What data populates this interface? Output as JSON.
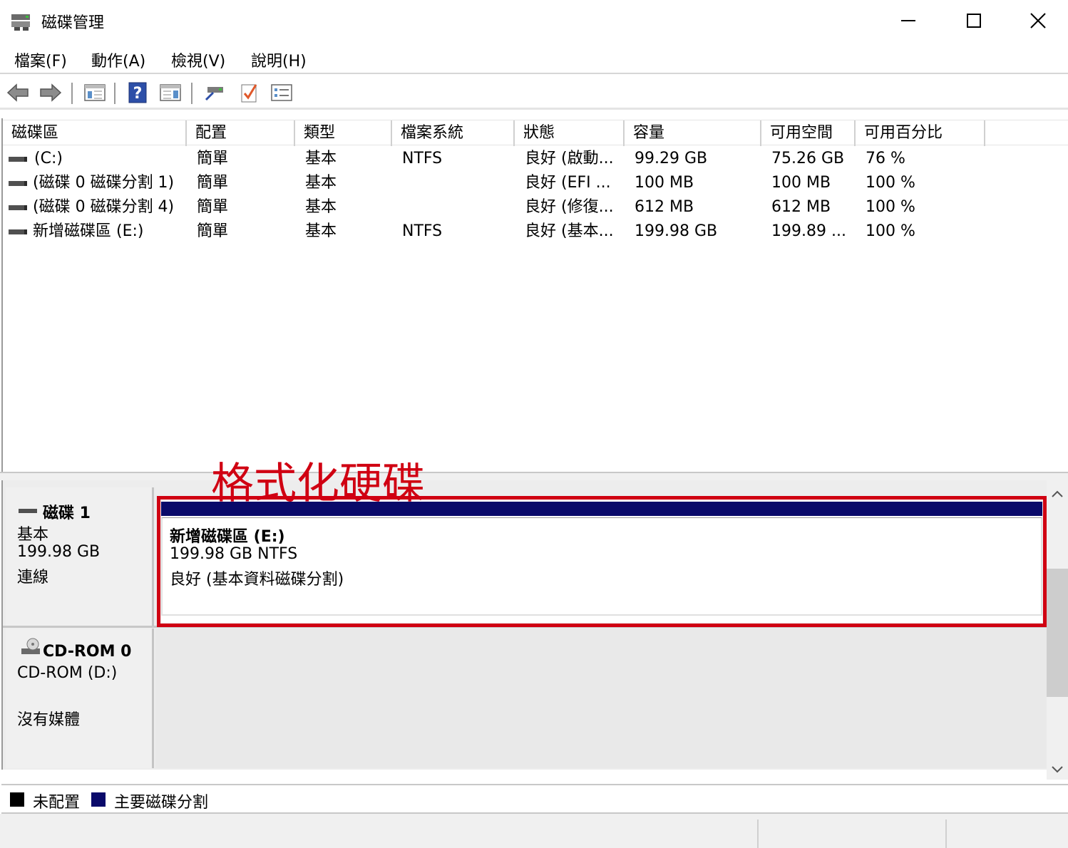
{
  "window": {
    "title": "磁碟管理",
    "icon": "disk-management-icon"
  },
  "menu": [
    "檔案(F)",
    "動作(A)",
    "檢視(V)",
    "說明(H)"
  ],
  "toolbar": {
    "buttons": [
      "back-icon",
      "forward-icon",
      "console-tree-icon",
      "help-icon",
      "properties-view-icon",
      "connect-disk-icon",
      "check-icon",
      "list-settings-icon"
    ]
  },
  "volumes": {
    "columns": [
      "磁碟區",
      "配置",
      "類型",
      "檔案系統",
      "狀態",
      "容量",
      "可用空間",
      "可用百分比"
    ],
    "rows": [
      [
        "(C:)",
        "簡單",
        "基本",
        "NTFS",
        "良好 (啟動...",
        "99.29 GB",
        "75.26 GB",
        "76 %"
      ],
      [
        "(磁碟 0 磁碟分割 1)",
        "簡單",
        "基本",
        "",
        "良好 (EFI ...",
        "100 MB",
        "100 MB",
        "100 %"
      ],
      [
        "(磁碟 0 磁碟分割 4)",
        "簡單",
        "基本",
        "",
        "良好 (修復...",
        "612 MB",
        "612 MB",
        "100 %"
      ],
      [
        "新增磁碟區 (E:)",
        "簡單",
        "基本",
        "NTFS",
        "良好 (基本...",
        "199.98 GB",
        "199.89 ...",
        "100 %"
      ]
    ]
  },
  "disks": {
    "disk1": {
      "name": "磁碟 1",
      "type": "基本",
      "size": "199.98 GB",
      "status": "連線",
      "partition": {
        "name": "新增磁碟區  (E:)",
        "size_fs": "199.98 GB NTFS",
        "status": "良好 (基本資料磁碟分割)"
      }
    },
    "cdrom0": {
      "name": "CD-ROM 0",
      "type": "CD-ROM (D:)",
      "status": "沒有媒體"
    }
  },
  "annotation": {
    "text": "格式化硬碟",
    "color": "#d00012"
  },
  "legend": [
    {
      "label": "未配置",
      "color": "#000000"
    },
    {
      "label": "主要磁碟分割",
      "color": "#0a0a6a"
    }
  ]
}
